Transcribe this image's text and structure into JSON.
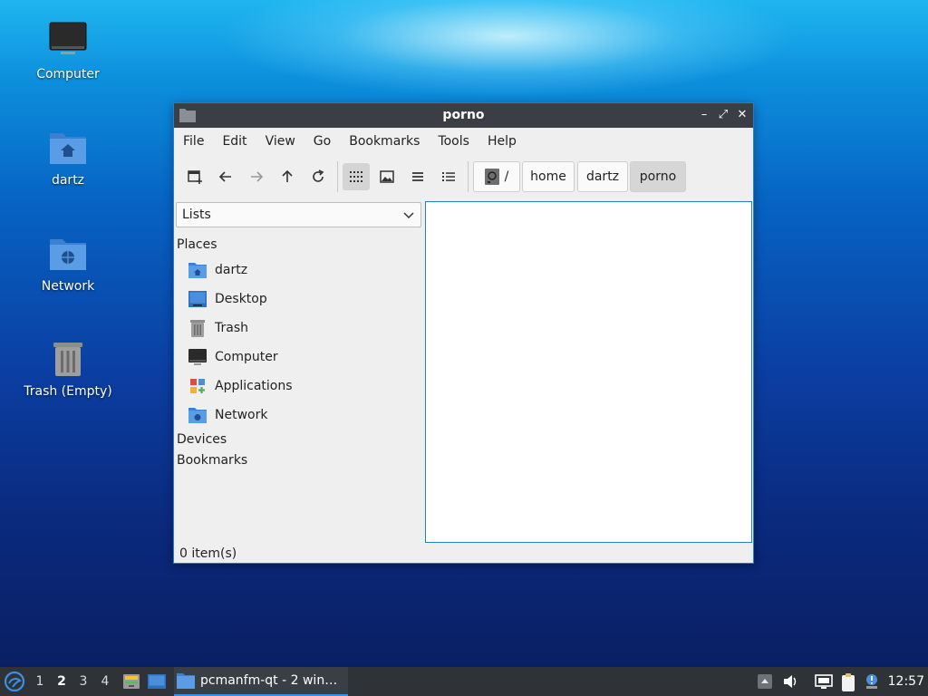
{
  "desktop": {
    "icons": [
      {
        "label": "Computer"
      },
      {
        "label": "dartz"
      },
      {
        "label": "Network"
      },
      {
        "label": "Trash (Empty)"
      }
    ]
  },
  "window": {
    "title": "porno",
    "titlebar_buttons": {
      "minimize": "–",
      "maximize": "⤢",
      "close": "✕"
    },
    "menu": [
      "File",
      "Edit",
      "View",
      "Go",
      "Bookmarks",
      "Tools",
      "Help"
    ],
    "toolbar": {
      "new_tab_icon": "new-tab-icon",
      "back_icon": "arrow-left-icon",
      "forward_icon": "arrow-right-icon",
      "up_icon": "arrow-up-icon",
      "reload_icon": "reload-icon",
      "icon_view_icon": "grid-icon",
      "thumbnail_view_icon": "image-icon",
      "compact_view_icon": "list-icon",
      "detailed_view_icon": "detailed-list-icon"
    },
    "breadcrumbs": [
      "/",
      "home",
      "dartz",
      "porno"
    ],
    "side_pane": {
      "mode": "Lists",
      "places_heading": "Places",
      "places": [
        {
          "label": "dartz",
          "icon": "home-folder-icon"
        },
        {
          "label": "Desktop",
          "icon": "desktop-icon"
        },
        {
          "label": "Trash",
          "icon": "trash-icon"
        },
        {
          "label": "Computer",
          "icon": "computer-icon"
        },
        {
          "label": "Applications",
          "icon": "applications-icon"
        },
        {
          "label": "Network",
          "icon": "network-folder-icon"
        }
      ],
      "devices_heading": "Devices",
      "bookmarks_heading": "Bookmarks"
    },
    "status": "0 item(s)"
  },
  "taskbar": {
    "workspaces": [
      "1",
      "2",
      "3",
      "4"
    ],
    "current_workspace": "2",
    "task_label": "pcmanfm-qt - 2 windo…",
    "clock": "12:57"
  },
  "colors": {
    "accent": "#2b7bd0",
    "titlebar": "#3b3f45",
    "taskbar": "#2f3337",
    "folder_blue": "#4a8fdc"
  }
}
